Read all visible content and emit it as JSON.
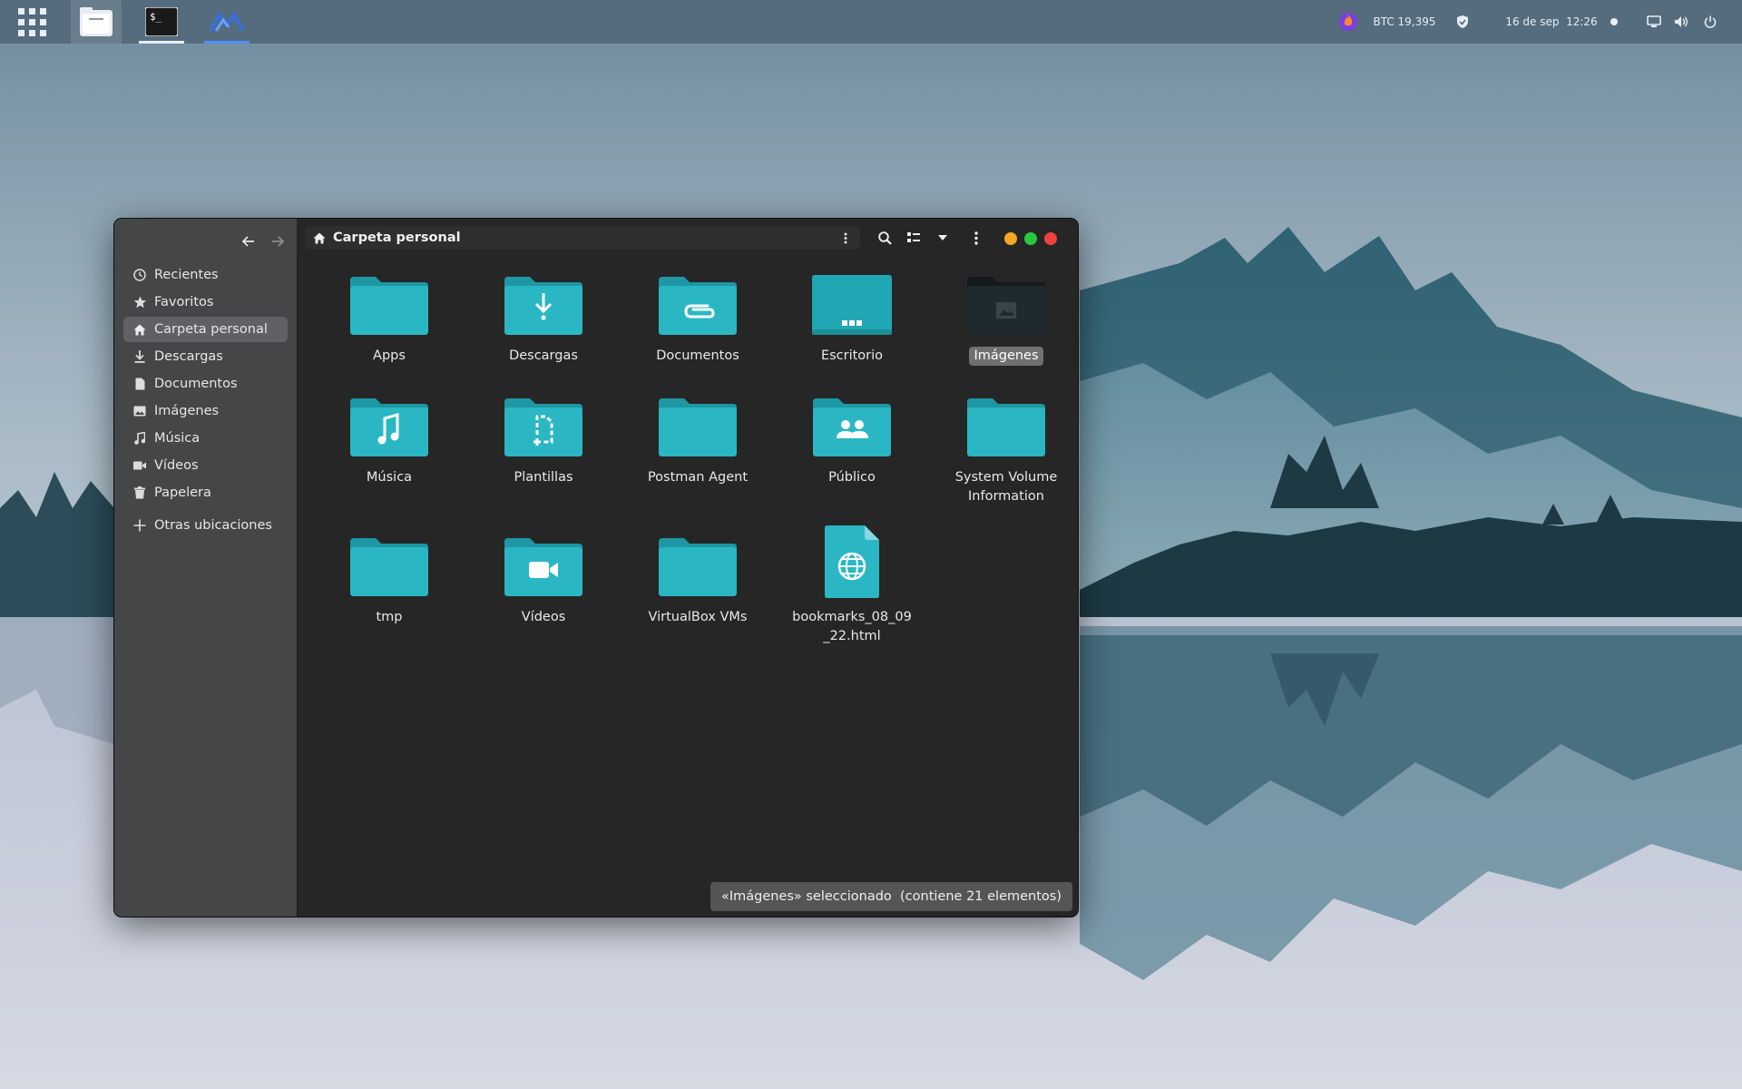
{
  "topbar": {
    "tasks": [
      {
        "name": "files-app",
        "active": true
      },
      {
        "name": "terminal-app",
        "active": false
      },
      {
        "name": "mailspring-app",
        "active": false
      }
    ],
    "btc": "BTC 19,395",
    "datetime": "16 de sep  12:26"
  },
  "window": {
    "path": "Carpeta personal",
    "sidebar": [
      {
        "label": "Recientes",
        "icon": "clock-icon"
      },
      {
        "label": "Favoritos",
        "icon": "star-icon"
      },
      {
        "label": "Carpeta personal",
        "icon": "home-icon",
        "active": true
      },
      {
        "label": "Descargas",
        "icon": "download-icon"
      },
      {
        "label": "Documentos",
        "icon": "document-icon"
      },
      {
        "label": "Imágenes",
        "icon": "image-icon"
      },
      {
        "label": "Música",
        "icon": "music-icon"
      },
      {
        "label": "Vídeos",
        "icon": "video-icon"
      },
      {
        "label": "Papelera",
        "icon": "trash-icon"
      }
    ],
    "other_locations": "Otras ubicaciones",
    "files": [
      {
        "label": "Apps",
        "emblem": "none"
      },
      {
        "label": "Descargas",
        "emblem": "download"
      },
      {
        "label": "Documentos",
        "emblem": "paperclip"
      },
      {
        "label": "Escritorio",
        "emblem": "desktop"
      },
      {
        "label": "Imágenes",
        "emblem": "image",
        "selected": true
      },
      {
        "label": "Música",
        "emblem": "music"
      },
      {
        "label": "Plantillas",
        "emblem": "template"
      },
      {
        "label": "Postman Agent",
        "emblem": "none"
      },
      {
        "label": "Público",
        "emblem": "people"
      },
      {
        "label": "System Volume Information",
        "emblem": "none"
      },
      {
        "label": "tmp",
        "emblem": "none"
      },
      {
        "label": "Vídeos",
        "emblem": "video"
      },
      {
        "label": "VirtualBox VMs",
        "emblem": "none"
      },
      {
        "label": "bookmarks_08_09_22.html",
        "emblem": "html-file"
      }
    ],
    "status": "«Imágenes» seleccionado  (contiene 21 elementos)"
  },
  "colors": {
    "folder": "#2ab7c3",
    "folder_dark": "#1d97a3",
    "selected_folder": "#1f2a2e",
    "minimize": "#f5a623",
    "maximize": "#27c93f",
    "close": "#f0413f"
  }
}
